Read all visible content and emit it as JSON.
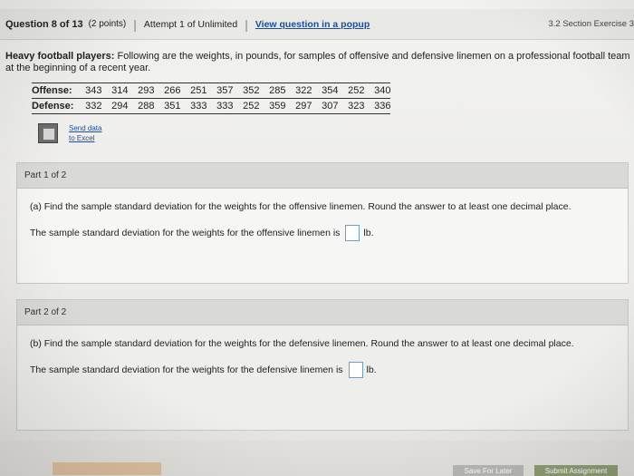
{
  "header": {
    "question_label": "Question 8 of 13",
    "points": "(2 points)",
    "attempt": "Attempt 1 of Unlimited",
    "popup_link": "View question in a popup",
    "section": "3.2 Section Exercise 3"
  },
  "question": {
    "title": "Heavy football players:",
    "text": "Following are the weights, in pounds, for samples of offensive and defensive linemen on a professional football team at the beginning of a recent year."
  },
  "data_table": {
    "rows": [
      {
        "label": "Offense:",
        "values": [
          "343",
          "314",
          "293",
          "266",
          "251",
          "357",
          "352",
          "285",
          "322",
          "354",
          "252",
          "340"
        ]
      },
      {
        "label": "Defense:",
        "values": [
          "332",
          "294",
          "288",
          "351",
          "333",
          "333",
          "252",
          "359",
          "297",
          "307",
          "323",
          "336"
        ]
      }
    ]
  },
  "excel": {
    "line1": "Send data",
    "line2": "to Excel"
  },
  "part1": {
    "header": "Part 1 of 2",
    "question": "(a) Find the sample standard deviation for the weights for the offensive linemen. Round the answer to at least one decimal place.",
    "answer_prefix": "The sample standard deviation for the weights for the offensive linemen is",
    "unit": "lb."
  },
  "part2": {
    "header": "Part 2 of 2",
    "question": "(b) Find the sample standard deviation for the weights for the defensive linemen. Round the answer to at least one decimal place.",
    "answer_prefix": "The sample standard deviation for the weights for the defensive linemen is",
    "unit": "lb."
  },
  "footer": {
    "save_label": "Save For Later",
    "submit_label": "Submit Assignment"
  }
}
